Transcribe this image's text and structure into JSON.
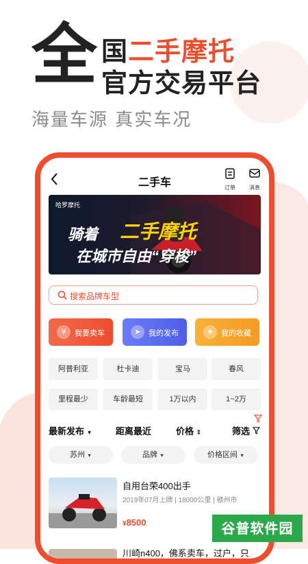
{
  "promo": {
    "big_char": "全",
    "line1_prefix": "国",
    "line1_highlight": "二手摩托",
    "line2": "官方交易平台",
    "subtitle": "海量车源  真实车况"
  },
  "colors": {
    "accent": "#ee4d2e",
    "blue": "#5b6cf0",
    "orange": "#f6a52f",
    "watermark": "#2aa84a"
  },
  "nav": {
    "back_icon": "chevron-left-icon",
    "title": "二手车",
    "orders_label": "订单",
    "messages_label": "消息"
  },
  "banner": {
    "logo_text": "哈罗摩托",
    "line1": "骑着",
    "line1_highlight": "二手摩托",
    "line2": "在城市自由“穿梭”"
  },
  "search": {
    "placeholder": "搜索品牌车型"
  },
  "quick_actions": [
    {
      "label": "我要卖车",
      "icon": "yen-icon"
    },
    {
      "label": "我的发布",
      "icon": "send-icon"
    },
    {
      "label": "我的收藏",
      "icon": "star-icon"
    }
  ],
  "quick_filters": [
    "阿普利亚",
    "杜卡迪",
    "宝马",
    "春风",
    "里程最少",
    "车龄最短",
    "1万以内",
    "1~2万"
  ],
  "sort": {
    "latest": "最新发布",
    "nearest": "距离最近",
    "price": "价格",
    "filter": "筛选"
  },
  "pills": [
    "苏州",
    "品牌",
    "价格区间"
  ],
  "listings": [
    {
      "title": "自用台荣400出手",
      "meta": "2019年07月上牌 | 18000公里 | 赣州市",
      "currency": "¥",
      "price": "8500"
    },
    {
      "title": "川崎n400，佛系卖车，过户，只"
    }
  ],
  "watermark": "谷普软件园"
}
